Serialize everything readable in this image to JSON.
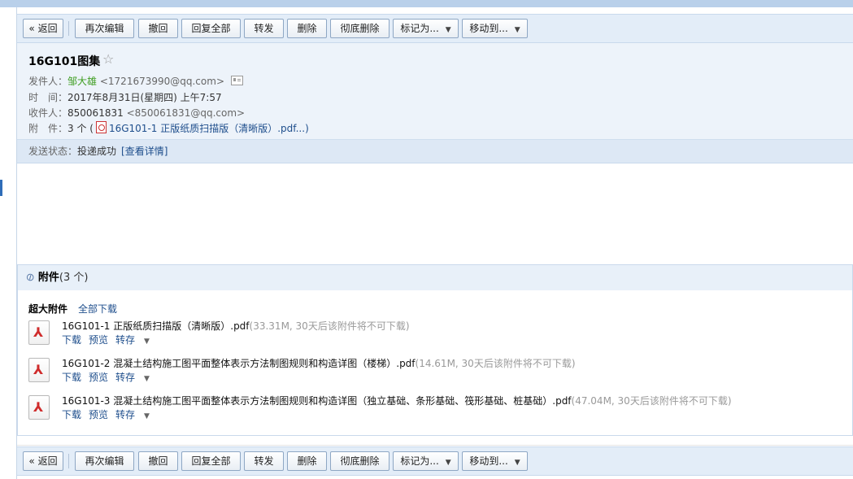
{
  "toolbar": {
    "back": "« 返回",
    "reedit": "再次编辑",
    "recall": "撤回",
    "reply_all": "回复全部",
    "forward": "转发",
    "delete": "删除",
    "delete_permanent": "彻底删除",
    "mark_as": "标记为...",
    "move_to": "移动到..."
  },
  "email": {
    "subject": "16G101图集",
    "from_label": "发件人：",
    "from_name": "邹大雄",
    "from_addr": "<1721673990@qq.com>",
    "time_label": "时　间：",
    "time_value": "2017年8月31日(星期四) 上午7:57",
    "to_label": "收件人：",
    "to_name": "850061831",
    "to_addr": "<850061831@qq.com>",
    "attach_label": "附　件：",
    "attach_count": "3 个 (",
    "attach_first": "16G101-1 正版纸质扫描版（清晰版）.pdf...)",
    "status_label": "发送状态：",
    "status_value": "投递成功",
    "status_link": "[查看详情]"
  },
  "attachments": {
    "title": "附件",
    "count": "(3 个)",
    "big_label": "超大附件",
    "download_all": "全部下载",
    "download": "下载",
    "preview": "预览",
    "save_to": "转存",
    "files": [
      {
        "name": "16G101-1 正版纸质扫描版（清晰版）.pdf",
        "meta": "(33.31M, 30天后该附件将不可下载)"
      },
      {
        "name": "16G101-2 混凝土结构施工图平面整体表示方法制图规则和构造详图（楼梯）.pdf",
        "meta": "(14.61M, 30天后该附件将不可下载)"
      },
      {
        "name": "16G101-3 混凝土结构施工图平面整体表示方法制图规则和构造详图（独立基础、条形基础、筏形基础、桩基础）.pdf",
        "meta": "(47.04M, 30天后该附件将不可下载)"
      }
    ]
  },
  "icons": {
    "star": "star-outline",
    "contact": "contact-card",
    "clip": "paperclip",
    "pdf": "pdf-file"
  },
  "colors": {
    "toolbar_bg": "#e3edf8",
    "header_bg": "#edf3fa",
    "link": "#1e4e8c",
    "sender": "#3e9d20",
    "pdf": "#cf2b2b"
  }
}
